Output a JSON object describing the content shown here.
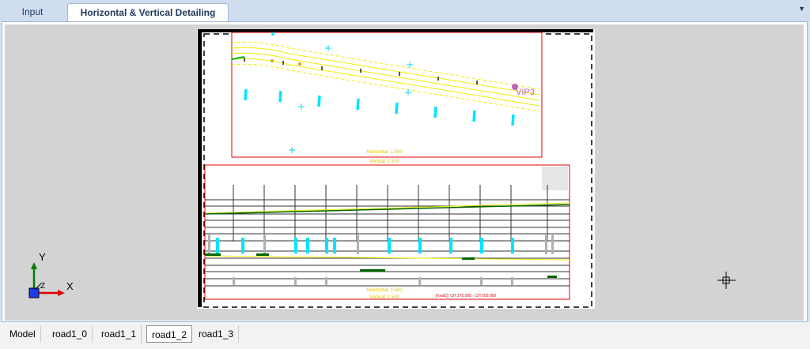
{
  "tabs": {
    "input": "Input",
    "horizontal_vertical": "Horizontal & Vertical Detailing",
    "dropdown_icon": "chevron-down-icon"
  },
  "drawing": {
    "vip_label": "VIP3",
    "plan_scale_h": "Horizontal: 1:500",
    "plan_scale_v": "Vertical: 1:500",
    "profile_scale_h": "Horizontal: 1:500",
    "profile_scale_v": "Vertical: 1:500",
    "chainage": "[road1]: CH 275.000 - CH 550.000"
  },
  "ucs": {
    "y_label": "Y",
    "x_label": "X",
    "z_label": "Z"
  },
  "layout_tabs": [
    "Model",
    "road1_0",
    "road1_1",
    "road1_2",
    "road1_3"
  ],
  "active_layout": "road1_2",
  "colors": {
    "viewport_bg": "#d3d3d3",
    "plan_border": "#e00000",
    "alignment": "#ffff00",
    "markers": "#00e5ff",
    "vip": "#c060c0"
  }
}
